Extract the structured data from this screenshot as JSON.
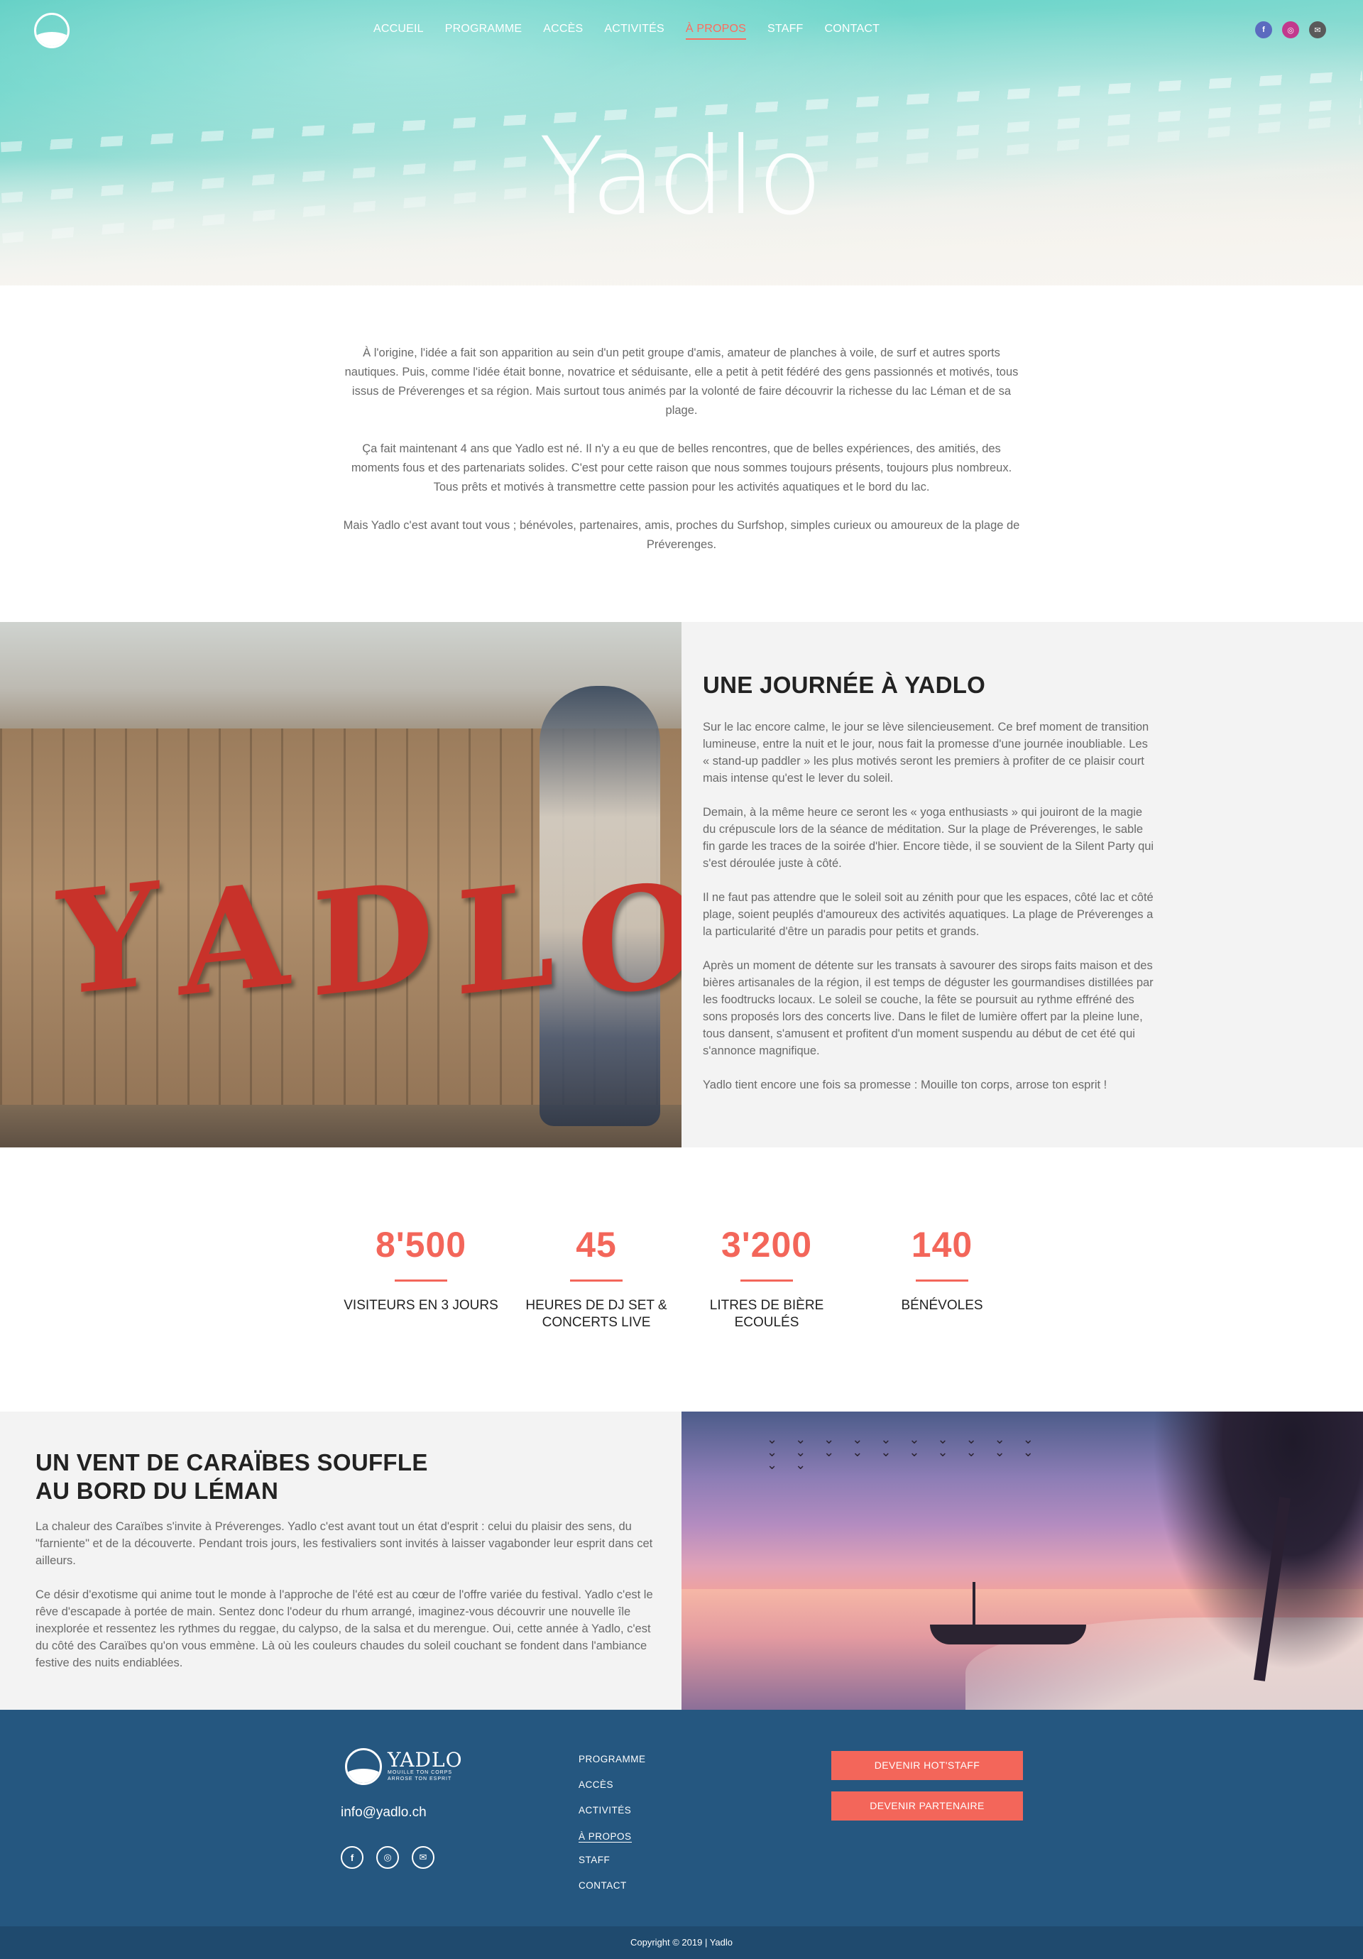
{
  "nav": {
    "items": [
      "ACCUEIL",
      "PROGRAMME",
      "ACCÈS",
      "ACTIVITÉS",
      "À PROPOS",
      "STAFF",
      "CONTACT"
    ],
    "active": "À PROPOS"
  },
  "hero": {
    "title": "Yadlo"
  },
  "intro": {
    "paragraphs": [
      "À l'origine, l'idée a fait son apparition au sein d'un petit groupe d'amis, amateur de planches à voile, de surf et autres sports nautiques. Puis, comme l'idée était bonne, novatrice et séduisante, elle a petit à petit fédéré des gens passionnés et motivés, tous issus de Préverenges et sa région. Mais surtout tous animés par la volonté de faire découvrir la richesse du lac Léman et de sa plage.",
      "Ça fait maintenant 4 ans que Yadlo est né. Il n'y a eu que de belles rencontres, que de belles expériences, des amitiés, des moments fous et des partenariats solides. C'est pour cette raison que nous sommes toujours présents, toujours plus nombreux. Tous prêts et motivés à transmettre cette passion pour les activités aquatiques et le bord du lac.",
      "Mais Yadlo c'est avant tout vous ; bénévoles, partenaires, amis, proches du Surfshop, simples curieux ou amoureux de la plage de Préverenges."
    ]
  },
  "day": {
    "image_letters": [
      "Y",
      "A",
      "D",
      "L",
      "O"
    ],
    "title": "UNE JOURNÉE À YADLO",
    "paragraphs": [
      "Sur le lac encore calme, le jour se lève silencieusement. Ce bref moment de transition lumineuse, entre la nuit et le jour, nous fait la promesse d'une journée inoubliable. Les « stand-up paddler » les plus motivés seront les premiers à profiter de ce plaisir court mais intense qu'est le lever du soleil.",
      "Demain, à la même heure ce seront les « yoga enthusiasts » qui jouiront de la magie du crépuscule lors de la séance de méditation. Sur la plage de Préverenges, le sable fin garde les traces de la soirée d'hier. Encore tiède, il se souvient de la Silent Party qui s'est déroulée juste à côté.",
      "Il ne faut pas attendre que le soleil soit au zénith pour que les espaces, côté lac et côté plage, soient peuplés d'amoureux des activités aquatiques. La plage de Préverenges a la particularité d'être un paradis pour petits et grands.",
      "Après un moment de détente sur les transats à savourer des sirops faits maison et des bières artisanales de la région, il est temps de déguster les gourmandises distillées par les foodtrucks locaux. Le soleil se couche, la fête se poursuit au rythme effréné des sons proposés lors des concerts live. Dans le filet de lumière offert par la pleine lune, tous dansent, s'amusent et profitent d'un moment suspendu au début de cet été qui s'annonce magnifique.",
      "Yadlo tient encore une fois sa promesse : Mouille ton corps, arrose ton esprit !"
    ]
  },
  "stats": [
    {
      "number": "8'500",
      "label": "VISITEURS EN 3 JOURS"
    },
    {
      "number": "45",
      "label": "HEURES DE DJ SET & CONCERTS LIVE"
    },
    {
      "number": "3'200",
      "label": "LITRES DE BIÈRE ECOULÉS"
    },
    {
      "number": "140",
      "label": "BÉNÉVOLES"
    }
  ],
  "caribbean": {
    "title": "UN VENT DE CARAÏBES SOUFFLE AU BORD DU LÉMAN",
    "paragraphs": [
      "La chaleur des Caraïbes s'invite à Préverenges. Yadlo c'est avant tout un état d'esprit : celui du plaisir des sens, du \"farniente\" et de la découverte. Pendant trois jours, les festivaliers sont invités à laisser vagabonder leur esprit dans cet ailleurs.",
      "Ce désir d'exotisme qui anime tout le monde à l'approche de l'été est au cœur de l'offre variée du festival. Yadlo c'est le rêve d'escapade à portée de main. Sentez donc l'odeur du rhum arrangé, imaginez-vous découvrir une nouvelle île inexplorée et ressentez les rythmes du reggae, du calypso, de la salsa et du merengue. Oui, cette année à Yadlo, c'est du côté des Caraïbes qu'on vous emmène. Là où les couleurs chaudes du soleil couchant se fondent dans l'ambiance festive des nuits endiablées."
    ]
  },
  "footer": {
    "logo_wordmark": "YADLO",
    "logo_tagline_1": "MOUILLE TON CORPS",
    "logo_tagline_2": "ARROSE TON ESPRIT",
    "email": "info@yadlo.ch",
    "menu": [
      "PROGRAMME",
      "ACCÈS",
      "ACTIVITÉS",
      "À PROPOS",
      "STAFF",
      "CONTACT"
    ],
    "active": "À PROPOS",
    "btn_hotstaff": "DEVENIR HOT'STAFF",
    "btn_partner": "DEVENIR PARTENAIRE",
    "copyright": "Copyright © 2019 | Yadlo"
  },
  "colors": {
    "accent": "#f3665a",
    "footer_bg": "#255780",
    "copyright_bg": "#1f4a6e",
    "section_grey": "#f3f3f3"
  },
  "icons": {
    "social": [
      "facebook-icon",
      "instagram-icon",
      "mail-icon"
    ]
  }
}
